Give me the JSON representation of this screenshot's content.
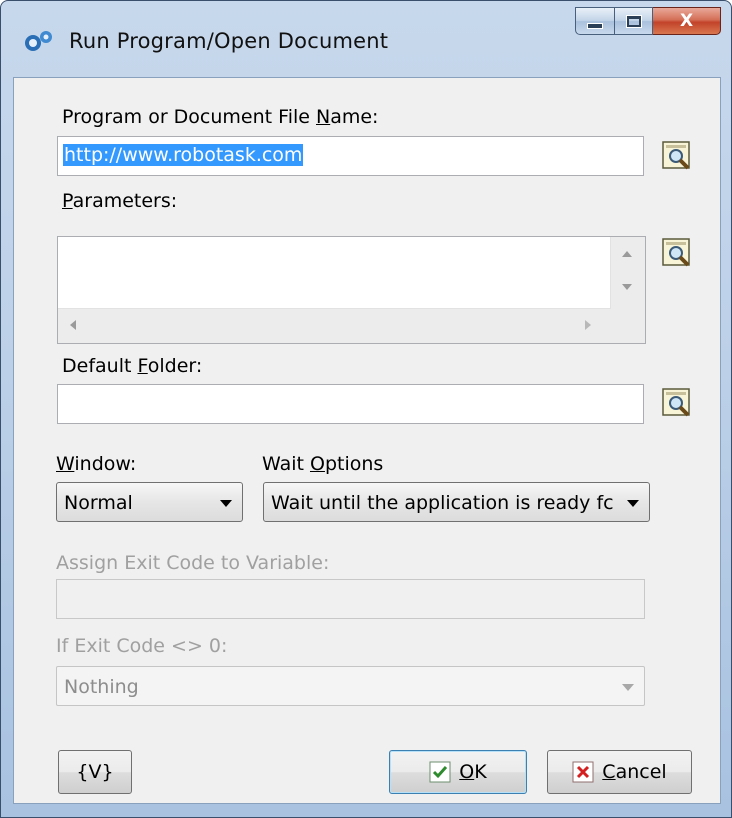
{
  "window": {
    "title": "Run Program/Open Document",
    "minimize": "minimize",
    "maximize": "maximize",
    "close": "X"
  },
  "program": {
    "label_pre": "Program or Document File ",
    "label_acc": "N",
    "label_post": "ame:",
    "value": "http://www.robotask.com"
  },
  "parameters": {
    "label_acc": "P",
    "label_post": "arameters:",
    "value": ""
  },
  "folder": {
    "label_pre": "Default ",
    "label_acc": "F",
    "label_post": "older:",
    "value": ""
  },
  "window_mode": {
    "label_acc": "W",
    "label_post": "indow:",
    "selected": "Normal"
  },
  "wait": {
    "label_pre": "Wait ",
    "label_acc": "O",
    "label_post": "ptions",
    "selected": "Wait until the application is ready fc"
  },
  "exit_code": {
    "label": "Assign Exit Code to Variable:",
    "value": ""
  },
  "if_exit": {
    "label": "If Exit Code <> 0:",
    "selected": "Nothing"
  },
  "buttons": {
    "variables": "{V}",
    "ok_acc": "O",
    "ok_post": "K",
    "cancel_acc": "C",
    "cancel_post": "ancel"
  },
  "colors": {
    "selection": "#3399ff",
    "ok_check": "#2e8b2e",
    "cancel_x": "#d42020"
  }
}
